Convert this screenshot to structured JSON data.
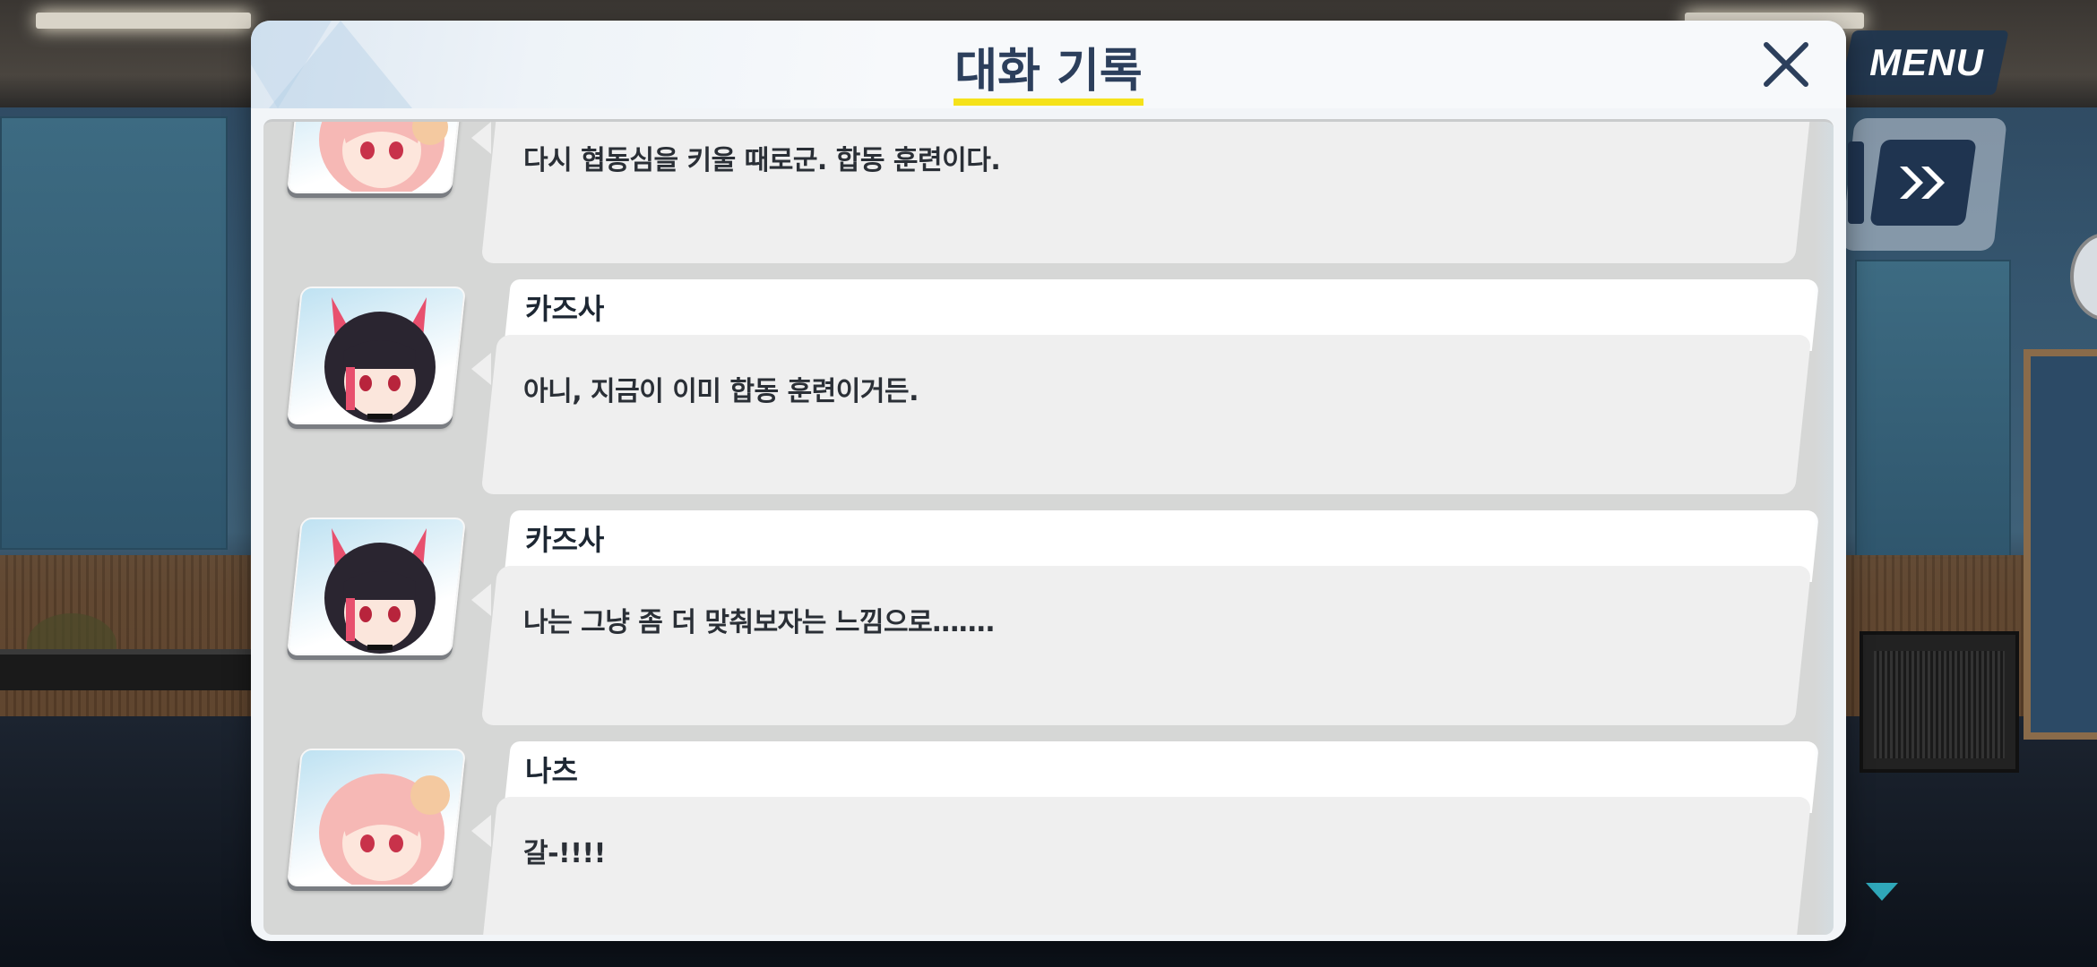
{
  "hud": {
    "menu_label": "MENU",
    "fast_forward_icon": "double-chevron-right-icon"
  },
  "dialog": {
    "title": "대화 기록",
    "close_icon": "close-icon",
    "accent_color": "#f5e21a",
    "entries": [
      {
        "speaker": "",
        "portrait": "natsu",
        "text": "다시 협동심을 키울 때로군. 합동 훈련이다."
      },
      {
        "speaker": "카즈사",
        "portrait": "kazusa",
        "text": "아니, 지금이 이미 합동 훈련이거든."
      },
      {
        "speaker": "카즈사",
        "portrait": "kazusa",
        "text": "나는 그냥 좀 더 맞춰보자는 느낌으로……."
      },
      {
        "speaker": "나츠",
        "portrait": "natsu",
        "text": "갈-!!!!"
      }
    ]
  }
}
